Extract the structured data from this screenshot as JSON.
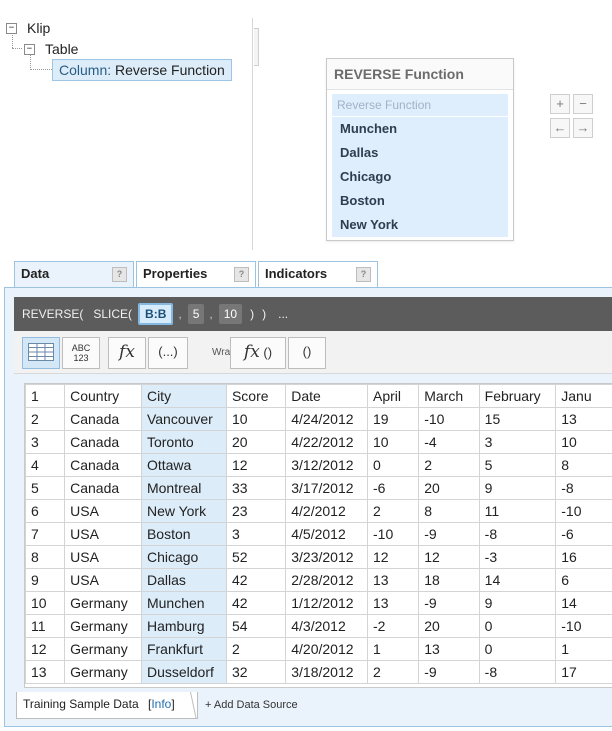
{
  "tree": {
    "root_label": "Klip",
    "child_label": "Table",
    "selected_key": "Column:",
    "selected_value": "Reverse Function",
    "expand_symbol": "−"
  },
  "preview": {
    "title": "REVERSE Function",
    "column_header": "Reverse Function",
    "items": [
      "Munchen",
      "Dallas",
      "Chicago",
      "Boston",
      "New York"
    ],
    "controls": {
      "add": "+",
      "remove": "−",
      "left": "←",
      "right": "→"
    }
  },
  "tabs": [
    {
      "label": "Data",
      "help": "?"
    },
    {
      "label": "Properties",
      "help": "?"
    },
    {
      "label": "Indicators",
      "help": "?"
    }
  ],
  "formula": {
    "fn1": "REVERSE(",
    "fn2": "SLICE(",
    "arg1": "B:B",
    "comma": ",",
    "arg2": "5",
    "arg3": "10",
    "close1": ")",
    "close2": ")",
    "more": "..."
  },
  "toolbar": {
    "abc_top": "ABC",
    "abc_bottom": "123",
    "fx": "fx",
    "group": "(...)",
    "wrap_label": "Wrap",
    "wrap_group": "()"
  },
  "grid": {
    "header": [
      "1",
      "Country",
      "City",
      "Score",
      "Date",
      "April",
      "March",
      "February",
      "Janu"
    ],
    "rows": [
      [
        "2",
        "Canada",
        "Vancouver",
        "10",
        "4/24/2012",
        "19",
        "-10",
        "15",
        "13"
      ],
      [
        "3",
        "Canada",
        "Toronto",
        "20",
        "4/22/2012",
        "10",
        "-4",
        "3",
        "10"
      ],
      [
        "4",
        "Canada",
        "Ottawa",
        "12",
        "3/12/2012",
        "0",
        "2",
        "5",
        "8"
      ],
      [
        "5",
        "Canada",
        "Montreal",
        "33",
        "3/17/2012",
        "-6",
        "20",
        "9",
        "-8"
      ],
      [
        "6",
        "USA",
        "New York",
        "23",
        "4/2/2012",
        "2",
        "8",
        "11",
        "-10"
      ],
      [
        "7",
        "USA",
        "Boston",
        "3",
        "4/5/2012",
        "-10",
        "-9",
        "-8",
        "-6"
      ],
      [
        "8",
        "USA",
        "Chicago",
        "52",
        "3/23/2012",
        "12",
        "12",
        "-3",
        "16"
      ],
      [
        "9",
        "USA",
        "Dallas",
        "42",
        "2/28/2012",
        "13",
        "18",
        "14",
        "6"
      ],
      [
        "10",
        "Germany",
        "Munchen",
        "42",
        "1/12/2012",
        "13",
        "-9",
        "9",
        "14"
      ],
      [
        "11",
        "Germany",
        "Hamburg",
        "54",
        "4/3/2012",
        "-2",
        "20",
        "0",
        "-10"
      ],
      [
        "12",
        "Germany",
        "Frankfurt",
        "2",
        "4/20/2012",
        "1",
        "13",
        "0",
        "1"
      ],
      [
        "13",
        "Germany",
        "Dusseldorf",
        "32",
        "3/18/2012",
        "2",
        "-9",
        "-8",
        "17"
      ]
    ],
    "selected_column": 2
  },
  "bottom": {
    "tab_label": "Training Sample Data",
    "info_open": "[",
    "info_link": "Info",
    "info_close": "]",
    "add_source": "+ Add Data Source"
  }
}
